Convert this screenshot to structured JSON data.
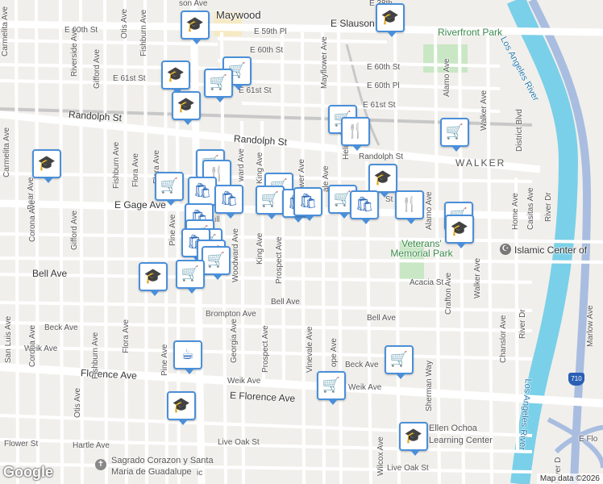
{
  "map": {
    "city": "Maywood",
    "neighborhood": "WALKER",
    "parks": [
      "Riverfront Park",
      "Veterans' Memorial Park"
    ],
    "river": "Los Angeles River",
    "river_lower": "Los Angeles River",
    "freeway": "710",
    "pois": {
      "islamic_center": "Islamic Center of",
      "church_line1": "Sagrado Corazon y Santa",
      "church_line2": "Maria de Guadalupe",
      "school_line1": "Ellen Ochoa",
      "school_line2": "Learning Center"
    },
    "streets": {
      "e_slauson": "E Slauson Ave",
      "e_60th": "E 60th St",
      "e_59th": "E 59th Pl",
      "e_60th_mid": "E 60th St",
      "e_61st_w": "E 61st St",
      "e_61st_mid": "E 61st St",
      "e_60th_e": "E 60th St",
      "e_60th_pl": "E 60th Pl",
      "e_61st_e": "E 61st St",
      "randolph_w": "Randolph St",
      "randolph_mid": "Randolph St",
      "randolph_e": "Randolph St",
      "e_gage": "E Gage Ave",
      "bell_w": "Bell Ave",
      "bell_mid": "Bell Ave",
      "bell_e": "Bell Ave",
      "acacia": "Acacia St",
      "brompton": "Brompton Ave",
      "beck_w": "Beck Ave",
      "beck_e": "Beck Ave",
      "weik_w": "Weik Ave",
      "weik_mid": "Weik Ave",
      "weik_e": "Weik Ave",
      "florence_w": "Florence Ave",
      "florence_e": "E Florence Ave",
      "hartle": "Hartle Ave",
      "flower_st": "Flower St",
      "live_oak": "Live Oak St",
      "live_oak_e": "Live Oak St",
      "e_flo_edge": "E Flo",
      "carmelita_n": "Carmelita Ave",
      "carmelita_s": "Carmelita Ave",
      "corona_n": "Corona Ave",
      "corona_s": "Corona Ave",
      "bear": "Bear Ave",
      "riverside": "Riverside Ave",
      "gifford_n": "Gifford Ave",
      "gifford_s": "Gifford Ave",
      "otis_n": "Otis Ave",
      "otis_s": "Otis Ave",
      "fishburn_n": "Fishburn Ave",
      "fishburn_mid": "Fishburn Ave",
      "fishburn_s": "Fishburn Ave",
      "flora_n": "Flora Ave",
      "flora_s": "Flora Ave",
      "san_luis": "San Luis Ave",
      "pine_n": "Pine Ave",
      "pine_s": "Pine Ave",
      "woodward": "Woodward Ave",
      "ward": "ward Ave",
      "georgia": "Georgia Ave",
      "king_n": "King Ave",
      "king_s": "King Ave",
      "prospect_n": "Prospect Ave",
      "prospect_s": "Prospect Ave",
      "flower_ave": "ower Ave",
      "mayflower": "Mayflower Ave",
      "vinevale": "Vinevale Ave",
      "vale": "ale Ave",
      "heliotrope_n": "Heliot",
      "hope": "ope Ave",
      "wilcox": "Wilcox Ave",
      "alamo_n": "Alamo Ave",
      "alamo_s": "Alamo Ave",
      "walker_n": "Walker Ave",
      "walker_s": "Walker Ave",
      "district": "District Blvd",
      "sherman": "Sherman Way",
      "crafton": "Crafton Ave",
      "chanslor": "Chanslor Ave",
      "home": "Home Ave",
      "casitas": "Casitas Ave",
      "river_dr_n": "River Dr",
      "river_dr_s": "River Dr",
      "marlow": "Marlow Ave",
      "river_d_edge": "River D",
      "ic_edge": "ic",
      "ill": "ill",
      "n_38th": "E 38th",
      "son_ave": "son Ave",
      "st_label": "St"
    },
    "icons": {
      "school": "graduation-cap-icon",
      "store": "shopping-cart-icon",
      "shop": "shopping-bag-icon",
      "restaurant": "fork-knife-icon",
      "cafe": "coffee-cup-icon"
    },
    "colors": {
      "pin_border": "#4a8fd9",
      "pin_icon": "#1e5fb3",
      "park": "#c9e7c4",
      "river": "#7ad0e8",
      "freeway": "#a8bde0",
      "road": "#ffffff"
    }
  },
  "brand": {
    "logo": "Google",
    "attribution": "Map data ©2026"
  }
}
